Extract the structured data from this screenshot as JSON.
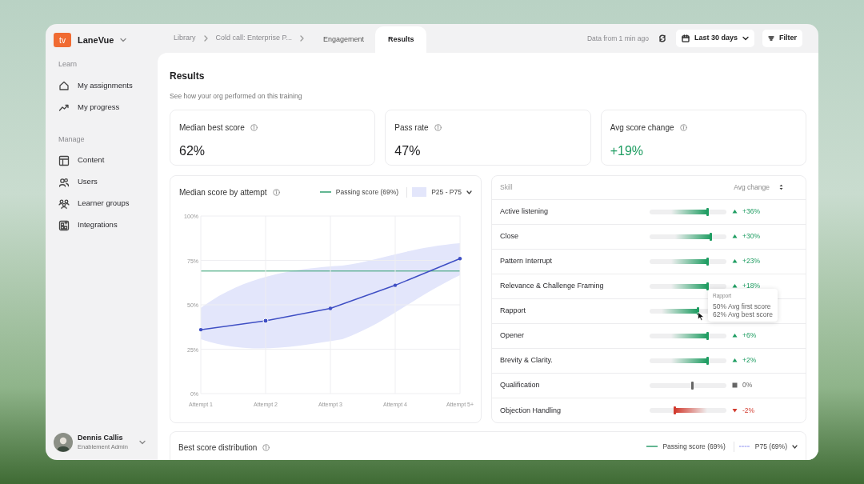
{
  "app": {
    "logo_text": "tv",
    "name": "LaneVue"
  },
  "sidebar": {
    "sections": [
      {
        "heading": "Learn",
        "items": [
          {
            "label": "My assignments"
          },
          {
            "label": "My progress"
          }
        ]
      },
      {
        "heading": "Manage",
        "items": [
          {
            "label": "Content"
          },
          {
            "label": "Users"
          },
          {
            "label": "Learner groups"
          },
          {
            "label": "Integrations"
          }
        ]
      }
    ]
  },
  "user": {
    "name": "Dennis Callis",
    "role": "Enablement Admin"
  },
  "breadcrumbs": [
    {
      "label": "Library"
    },
    {
      "label": "Cold call: Enterprise P..."
    }
  ],
  "tabs": [
    {
      "label": "Engagement",
      "selected": false
    },
    {
      "label": "Results",
      "selected": true
    }
  ],
  "toolbar": {
    "data_age": "Data from 1 min ago",
    "date_range": "Last 30 days",
    "filter": "Filter"
  },
  "page": {
    "title": "Results",
    "subtitle": "See how your org performed on this training"
  },
  "stats": [
    {
      "label": "Median best score",
      "value": "62%",
      "kind": "plain"
    },
    {
      "label": "Pass rate",
      "value": "47%",
      "kind": "plain"
    },
    {
      "label": "Avg score change",
      "value": "+19%",
      "kind": "positive"
    }
  ],
  "median_chart": {
    "title": "Median score by attempt",
    "legend_line": "Passing score (69%)",
    "band_select": "P25 - P75",
    "chart_data": {
      "type": "line",
      "categories": [
        "Attempt 1",
        "Attempt 2",
        "Attempt 3",
        "Attempt 4",
        "Attempt 5+"
      ],
      "ylim": [
        0,
        100
      ],
      "grid": true,
      "yticks": [
        {
          "value": 0,
          "label": "0%"
        },
        {
          "value": 25,
          "label": "25%"
        },
        {
          "value": 50,
          "label": "50%"
        },
        {
          "value": 75,
          "label": "75%"
        },
        {
          "value": 100,
          "label": "100%"
        }
      ],
      "series": [
        {
          "color": "#3f4fc4",
          "values": [
            36,
            41,
            48,
            61,
            76
          ]
        }
      ]
    }
  },
  "skills": {
    "columns": [
      "Skill",
      "Avg change"
    ],
    "rows": [
      {
        "name": "Active listening",
        "level": 0.75,
        "kind": "up",
        "change": "+36%"
      },
      {
        "name": "Close",
        "level": 0.8,
        "kind": "up",
        "change": "+30%"
      },
      {
        "name": "Pattern Interrupt",
        "level": 0.75,
        "kind": "up",
        "change": "+23%"
      },
      {
        "name": "Relevance & Challenge Framing",
        "level": 0.75,
        "kind": "up",
        "change": "+18%"
      },
      {
        "name": "Rapport",
        "level": 0.63,
        "kind": "up",
        "tooltip": {
          "title": "Rapport",
          "lines": [
            "50% Avg first score",
            "62% Avg best score"
          ]
        }
      },
      {
        "name": "Opener",
        "level": 0.75,
        "kind": "up",
        "change": "+6%"
      },
      {
        "name": "Brevity & Clarity.",
        "level": 0.75,
        "kind": "up",
        "change": "+2%"
      },
      {
        "name": "Qualification",
        "level": 0.56,
        "kind": "flat",
        "change": "0%"
      },
      {
        "name": "Objection Handling",
        "level": 0.33,
        "kind": "down",
        "change": "-2%"
      }
    ]
  },
  "distribution": {
    "title": "Best score distribution",
    "legend_line": "Passing score (69%)",
    "band_select": "P75 (69%)"
  }
}
